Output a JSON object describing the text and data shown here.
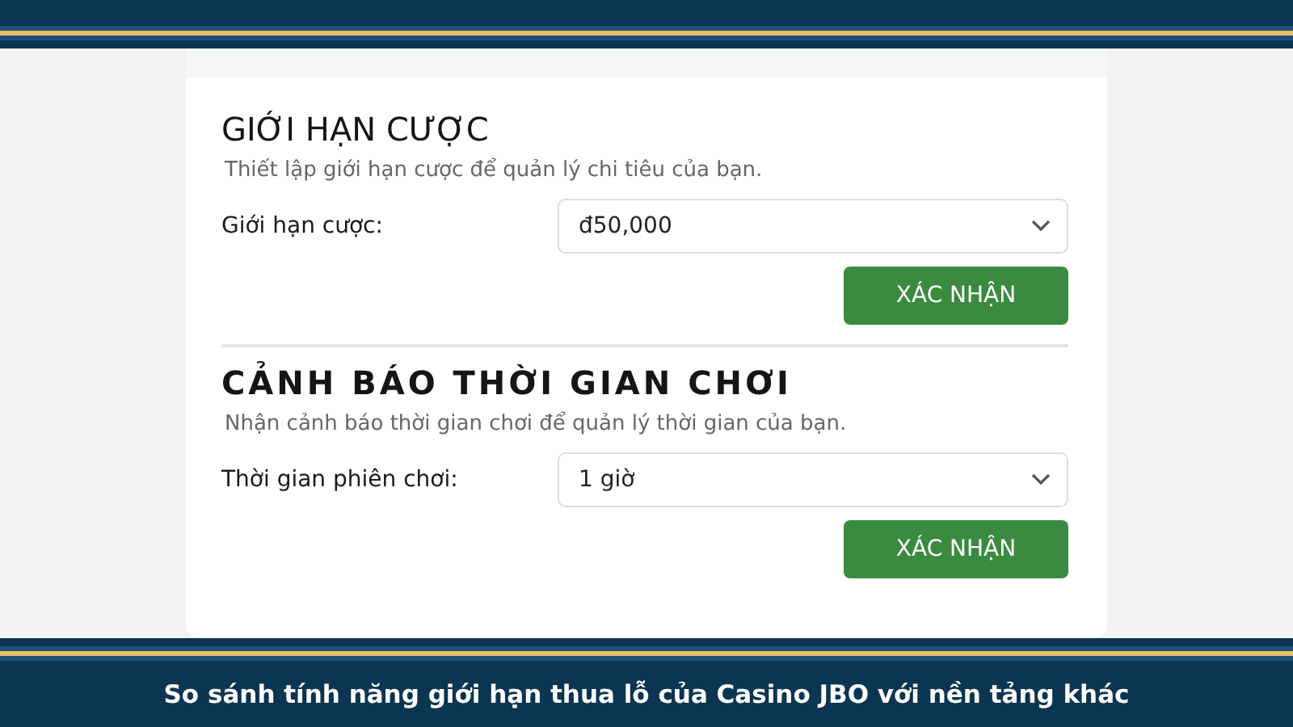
{
  "sections": [
    {
      "title": "GIỚI HẠN CƯỢC",
      "description": "Thiết lập giới hạn cược để quản lý chi tiêu của bạn.",
      "field_label": "Giới hạn cược:",
      "value": "đ50,000",
      "button": "XÁC NHẬN",
      "spaced": false
    },
    {
      "title": "CẢNH BÁO THỜI GIAN CHƠI",
      "description": "Nhận cảnh báo thời gian chơi để quản lý thời gian của bạn.",
      "field_label": "Thời gian phiên chơi:",
      "value": "1 giờ",
      "button": "XÁC NHẬN",
      "spaced": true
    }
  ],
  "caption": "So sánh tính năng giới hạn thua lỗ của Casino JBO với nền tảng khác"
}
